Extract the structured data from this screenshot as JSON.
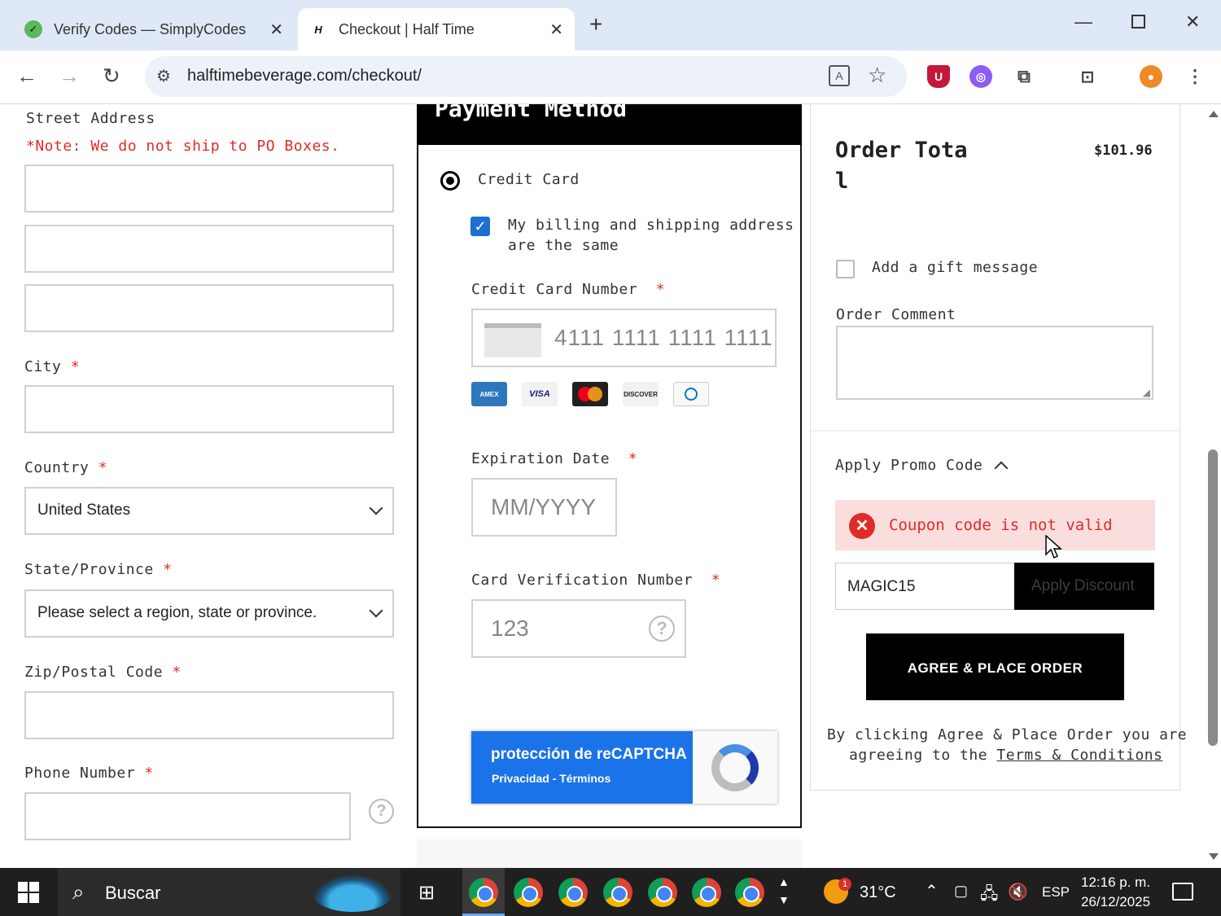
{
  "browser": {
    "tabs": [
      {
        "title": "Verify Codes — SimplyCodes",
        "icon": "simplycodes-favicon"
      },
      {
        "title": "Checkout | Half Time",
        "icon": "halftime-favicon"
      }
    ],
    "url": "halftimebeverage.com/checkout/"
  },
  "shipping": {
    "street_label": "Street Address",
    "street_note": "*Note: We do not ship to PO Boxes.",
    "city_label": "City",
    "country_label": "Country",
    "country_value": "United States",
    "state_label": "State/Province",
    "state_value": "Please select a region, state or province.",
    "zip_label": "Zip/Postal Code",
    "phone_label": "Phone Number",
    "required_mark": "*"
  },
  "payment": {
    "heading": "Payment Method",
    "method_label": "Credit Card",
    "same_address_label_1": "My billing and shipping address",
    "same_address_label_2": "are the same",
    "cc_number_label": "Credit Card Number",
    "cc_number_placeholder": "4111 1111 1111 1111",
    "card_logos": [
      "AMEX",
      "VISA",
      "Mastercard",
      "DISCOVER",
      "Diners Club"
    ],
    "exp_label": "Expiration Date",
    "exp_placeholder": "MM/YYYY",
    "cvv_label": "Card Verification Number",
    "cvv_placeholder": "123",
    "recaptcha_title": "protección de reCAPTCHA",
    "recaptcha_links": "Privacidad - Términos"
  },
  "summary": {
    "order_total_label_1": "Order Tota",
    "order_total_label_2": "l",
    "order_total_value": "$101.96",
    "gift_label": "Add a gift message",
    "comment_label": "Order Comment",
    "promo_label": "Apply Promo Code",
    "error_message": "Coupon code is not valid",
    "promo_value": "MAGIC15",
    "apply_button": "Apply Discount",
    "place_order_button": "AGREE & PLACE ORDER",
    "terms_text_1": "By clicking Agree & Place Order you are",
    "terms_text_2": "agreeing to the",
    "terms_link": "Terms & Conditions"
  },
  "taskbar": {
    "search_label": "Buscar",
    "weather": "31°C",
    "weather_badge": "1",
    "language": "ESP",
    "time": "12:16 p. m.",
    "date": "26/12/2025"
  }
}
